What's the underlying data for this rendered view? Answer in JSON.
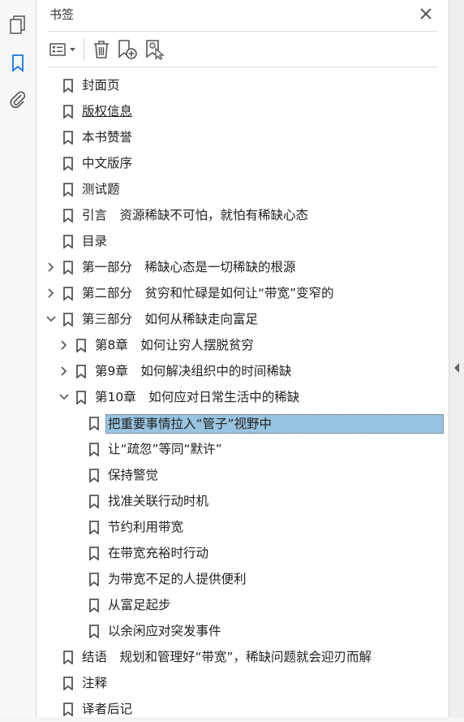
{
  "panel": {
    "title": "书签"
  },
  "bookmarks": [
    {
      "label": "封面页",
      "level": 0,
      "expander": "none"
    },
    {
      "label": "版权信息",
      "level": 0,
      "expander": "none",
      "underline": true
    },
    {
      "label": "本书赞誉",
      "level": 0,
      "expander": "none"
    },
    {
      "label": "中文版序",
      "level": 0,
      "expander": "none"
    },
    {
      "label": "测试题",
      "level": 0,
      "expander": "none"
    },
    {
      "label": "引言　资源稀缺不可怕，就怕有稀缺心态",
      "level": 0,
      "expander": "none"
    },
    {
      "label": "目录",
      "level": 0,
      "expander": "none"
    },
    {
      "label": "第一部分　稀缺心态是一切稀缺的根源",
      "level": 0,
      "expander": "collapsed"
    },
    {
      "label": "第二部分　贫穷和忙碌是如何让“带宽”变窄的",
      "level": 0,
      "expander": "collapsed"
    },
    {
      "label": "第三部分　如何从稀缺走向富足",
      "level": 0,
      "expander": "expanded"
    },
    {
      "label": "第8章　如何让穷人摆脱贫穷",
      "level": 1,
      "expander": "collapsed"
    },
    {
      "label": "第9章　如何解决组织中的时间稀缺",
      "level": 1,
      "expander": "collapsed"
    },
    {
      "label": "第10章　如何应对日常生活中的稀缺",
      "level": 1,
      "expander": "expanded"
    },
    {
      "label": "把重要事情拉入“管子”视野中",
      "level": 2,
      "expander": "none",
      "selected": true
    },
    {
      "label": "让“疏忽”等同“默许”",
      "level": 2,
      "expander": "none"
    },
    {
      "label": "保持警觉",
      "level": 2,
      "expander": "none"
    },
    {
      "label": "找准关联行动时机",
      "level": 2,
      "expander": "none"
    },
    {
      "label": "节约利用带宽",
      "level": 2,
      "expander": "none"
    },
    {
      "label": "在带宽充裕时行动",
      "level": 2,
      "expander": "none"
    },
    {
      "label": "为带宽不足的人提供便利",
      "level": 2,
      "expander": "none"
    },
    {
      "label": "从富足起步",
      "level": 2,
      "expander": "none"
    },
    {
      "label": "以余闲应对突发事件",
      "level": 2,
      "expander": "none"
    },
    {
      "label": "结语　规划和管理好“带宽”，稀缺问题就会迎刃而解",
      "level": 0,
      "expander": "none"
    },
    {
      "label": "注释",
      "level": 0,
      "expander": "none"
    },
    {
      "label": "译者后记",
      "level": 0,
      "expander": "none"
    }
  ],
  "colors": {
    "icon": "#555555",
    "active_icon": "#1473e6",
    "selection": "#99c4e1"
  }
}
